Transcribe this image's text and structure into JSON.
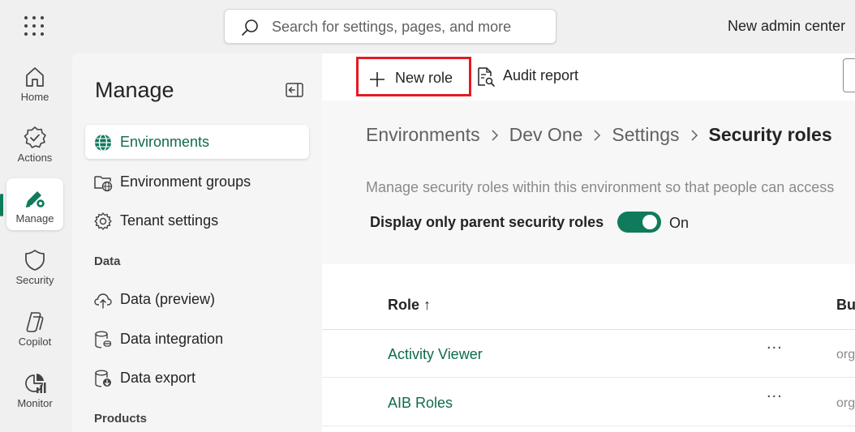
{
  "topbar": {
    "search_placeholder": "Search for settings, pages, and more",
    "admin_link": "New admin center"
  },
  "rail": {
    "items": [
      {
        "label": "Home",
        "icon": "home-icon"
      },
      {
        "label": "Actions",
        "icon": "actions-badge-icon"
      },
      {
        "label": "Manage",
        "icon": "manage-pen-gear-icon",
        "active": true
      },
      {
        "label": "Security",
        "icon": "shield-icon"
      },
      {
        "label": "Copilot",
        "icon": "copilot-icon"
      },
      {
        "label": "Monitor",
        "icon": "monitor-chart-icon"
      }
    ]
  },
  "pane": {
    "title": "Manage",
    "items": [
      {
        "label": "Environments",
        "icon": "globe-icon",
        "selected": true
      },
      {
        "label": "Environment groups",
        "icon": "folder-globe-icon"
      },
      {
        "label": "Tenant settings",
        "icon": "gear-icon"
      }
    ],
    "data_section": "Data",
    "data_items": [
      {
        "label": "Data (preview)",
        "icon": "cloud-upload-icon"
      },
      {
        "label": "Data integration",
        "icon": "database-link-icon"
      },
      {
        "label": "Data export",
        "icon": "database-export-icon"
      }
    ],
    "products_section": "Products"
  },
  "commands": {
    "new_role": "New role",
    "audit_report": "Audit report"
  },
  "breadcrumb": [
    "Environments",
    "Dev One",
    "Settings",
    "Security roles"
  ],
  "description": "Manage security roles within this environment so that people can access",
  "toggle": {
    "label": "Display only parent security roles",
    "state": "On",
    "enabled": true
  },
  "table": {
    "columns": [
      "Role ↑",
      "Bu"
    ],
    "rows": [
      {
        "role": "Activity Viewer",
        "more": "...",
        "bu": "org"
      },
      {
        "role": "AIB Roles",
        "more": "...",
        "bu": "org"
      }
    ]
  },
  "colors": {
    "accent": "#0f7b5c",
    "highlight": "#e31b23"
  }
}
